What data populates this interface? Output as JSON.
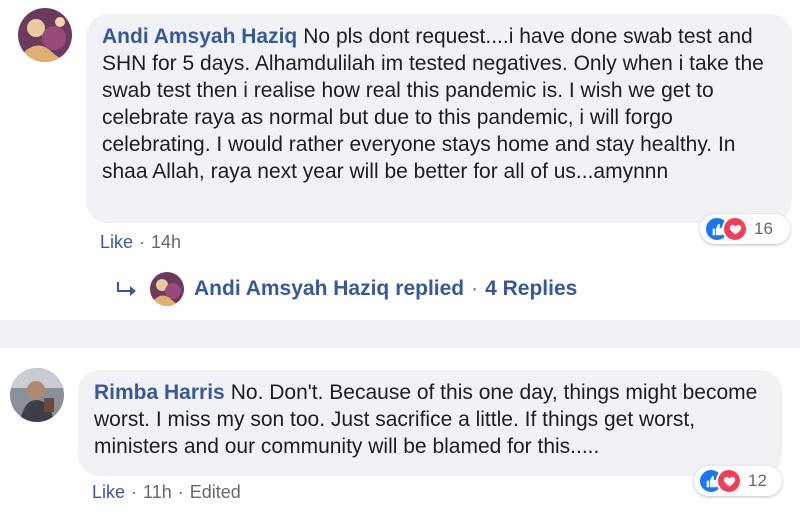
{
  "comments": [
    {
      "author": "Andi Amsyah Haziq",
      "text": "No pls dont request....i have done swab test and SHN for 5 days. Alhamdulilah im tested negatives. Only when i take the swab test then i realise how real this pandemic is. I wish we get to celebrate raya as normal but due to this pandemic, i will forgo celebrating. I would rather everyone stays home and stay healthy. In shaa Allah, raya next year will be better for all of us...amynnn",
      "like_label": "Like",
      "time": "14h",
      "reaction_count": "16",
      "reactions": [
        "like-icon",
        "love-icon"
      ],
      "replies": {
        "author": "Andi Amsyah Haziq",
        "action": "replied",
        "count_label": "4 Replies"
      }
    },
    {
      "author": "Rimba Harris",
      "text": "No. Don't. Because of this one day, things might become worst. I miss my son too. Just sacrifice a little. If things get worst, ministers and our community will be blamed for this.....",
      "like_label": "Like",
      "time": "11h",
      "edited_label": "Edited",
      "reaction_count": "12",
      "reactions": [
        "like-icon",
        "love-icon"
      ]
    }
  ],
  "separator": "·",
  "colors": {
    "link": "#385898",
    "bubble": "#f0f2f5",
    "meta": "#65676b",
    "like": "#1877f2",
    "love": "#f33e58"
  }
}
